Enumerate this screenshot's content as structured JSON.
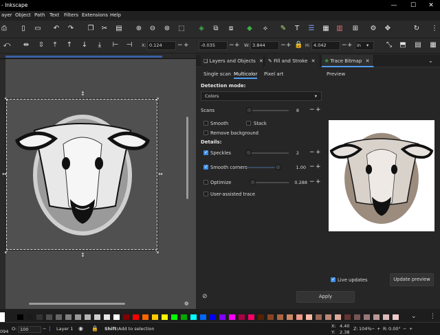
{
  "window": {
    "title": "- Inkscape",
    "minimize": "—",
    "maximize": "☐",
    "close": "✕"
  },
  "menu": [
    "ayer",
    "Object",
    "Path",
    "Text",
    "Filters",
    "Extensions",
    "Help"
  ],
  "controls": {
    "x_label": "X:",
    "x_value": "0.124",
    "y_label": "",
    "y_value": "-0.035",
    "w_label": "W:",
    "w_value": "3.844",
    "h_label": "H:",
    "h_value": "4.042",
    "unit": "in"
  },
  "dock": {
    "tabs": [
      {
        "label": "Layers and Objects"
      },
      {
        "label": "Fill and Stroke"
      },
      {
        "label": "Trace Bitmap"
      }
    ],
    "subtabs": [
      "Single scan",
      "Multicolor",
      "Pixel art"
    ],
    "preview_label": "Preview",
    "detection_mode_label": "Detection mode:",
    "detection_mode_value": "Colors",
    "scans_label": "Scans",
    "scans_value": "8",
    "smooth_label": "Smooth",
    "stack_label": "Stack",
    "remove_bg_label": "Remove background",
    "details_label": "Details:",
    "speckles_label": "Speckles",
    "speckles_value": "2",
    "smooth_corners_label": "Smooth corners",
    "smooth_corners_value": "1.00",
    "optimize_label": "Optimize",
    "optimize_value": "0.288",
    "user_assisted_label": "User-assisted trace",
    "live_updates_label": "Live updates",
    "update_preview_label": "Update preview",
    "apply_label": "Apply"
  },
  "status": {
    "left_value": "094",
    "opacity_label": "O:",
    "opacity_value": "100",
    "layer_label": "Layer 1",
    "hint_key": "Shift:",
    "hint_text": "Add to selection",
    "cursor_x_label": "X:",
    "cursor_x": "4.40",
    "cursor_y_label": "Y:",
    "cursor_y": "2.38",
    "zoom_label": "Z:",
    "zoom_value": "104%",
    "rotation_label": "R:",
    "rotation_value": "0.00°"
  },
  "colors": {
    "accent": "#4f9cf0",
    "checkbox": "#3d8ee8",
    "palette": [
      "#000000",
      "#1a1a1a",
      "#333333",
      "#4d4d4d",
      "#666666",
      "#808080",
      "#999999",
      "#b3b3b3",
      "#cccccc",
      "#e6e6e6",
      "#ffffff",
      "#800000",
      "#ff0000",
      "#ff6600",
      "#ffcc00",
      "#ffff00",
      "#00ff00",
      "#00aa00",
      "#00ffff",
      "#0066ff",
      "#0000ff",
      "#8000ff",
      "#ff00ff",
      "#aa0044",
      "#ff0066",
      "#552200",
      "#884422",
      "#aa6644",
      "#cc8866",
      "#ee9988",
      "#ffbbaa",
      "#996655",
      "#bb8877",
      "#ddaa99",
      "#663333",
      "#775555",
      "#997777",
      "#bb9999",
      "#ddbbbb",
      "#eecccc"
    ]
  }
}
